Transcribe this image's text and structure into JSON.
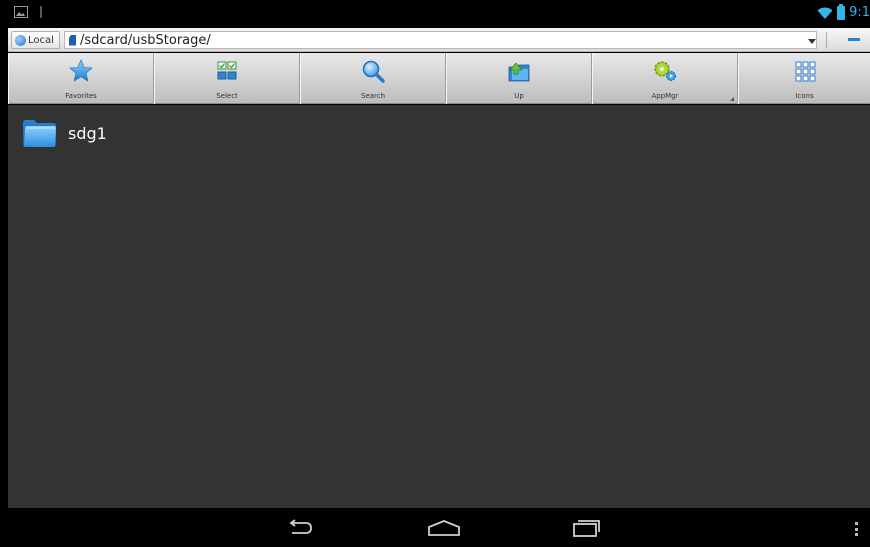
{
  "status_bar": {
    "time": "9:1",
    "icons": [
      "gallery-icon",
      "usb-icon",
      "wifi-icon",
      "battery-icon"
    ]
  },
  "path_bar": {
    "location_label": "Local",
    "path": "/sdcard/usbStorage/"
  },
  "toolbar": {
    "buttons": [
      {
        "label": "Favorites",
        "icon": "star-icon"
      },
      {
        "label": "Select",
        "icon": "select-grid-icon"
      },
      {
        "label": "Search",
        "icon": "magnifier-icon"
      },
      {
        "label": "Up",
        "icon": "folder-up-icon"
      },
      {
        "label": "AppMgr",
        "icon": "gear-icon"
      },
      {
        "label": "Icons",
        "icon": "icon-grid-icon"
      }
    ]
  },
  "files": [
    {
      "name": "sdg1",
      "type": "folder"
    }
  ],
  "nav_bar": {
    "buttons": [
      "back-icon",
      "home-icon",
      "recent-apps-icon",
      "overflow-menu-icon"
    ]
  },
  "colors": {
    "accent": "#33b5e5",
    "content_bg": "#333333",
    "folder": "#3a9be6"
  }
}
